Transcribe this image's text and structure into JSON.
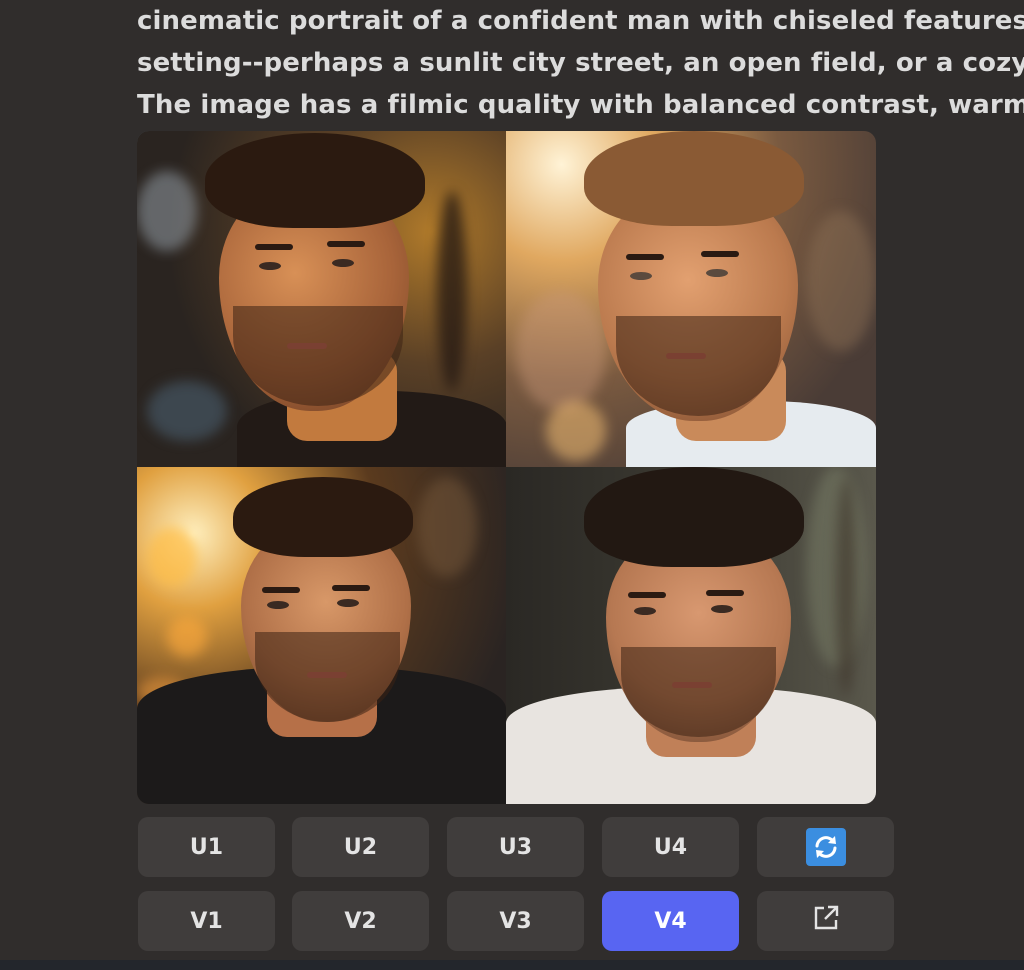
{
  "prompt": {
    "lines": [
      "cinematic portrait of a confident man with chiseled features",
      "setting--perhaps a sunlit city street, an open field, or a cozy",
      "The image has a filmic quality with balanced contrast, warm"
    ]
  },
  "image_grid": {
    "tiles": [
      {
        "position": "top-left",
        "subject": "portrait-man-dark-shirt"
      },
      {
        "position": "top-right",
        "subject": "portrait-man-white-shirt"
      },
      {
        "position": "bottom-left",
        "subject": "portrait-man-black-tshirt"
      },
      {
        "position": "bottom-right",
        "subject": "portrait-man-white-tshirt"
      }
    ]
  },
  "buttons": {
    "upscale": [
      "U1",
      "U2",
      "U3",
      "U4"
    ],
    "variation": [
      "V1",
      "V2",
      "V3",
      "V4"
    ],
    "refresh_icon": "refresh-icon",
    "open_icon": "external-link-icon",
    "active_button": "V4"
  },
  "colors": {
    "background": "#302d2c",
    "button": "#403d3c",
    "button_active": "#5865f2",
    "refresh_icon": "#3b8ee0",
    "text": "#dcdcdc"
  }
}
